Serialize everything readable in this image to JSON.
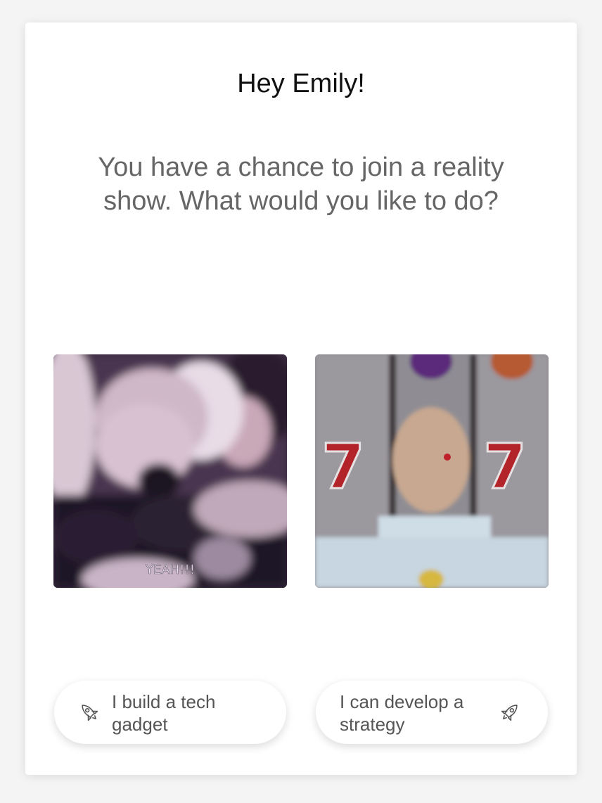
{
  "greeting": "Hey Emily!",
  "question": "You have a chance to join a reality show. What would you like to do?",
  "gifs": {
    "left": {
      "caption": "YEAH!!!"
    },
    "right": {
      "caption": "77"
    }
  },
  "options": [
    {
      "label": "I build a tech\ngadget",
      "icon": "rocket-icon"
    },
    {
      "label": "I can develop a\nstrategy",
      "icon": "rocket-icon"
    }
  ],
  "colors": {
    "background": "#f4f4f4",
    "card": "#ffffff",
    "greeting_text": "#111111",
    "question_text": "#666666",
    "option_text": "#555555"
  }
}
